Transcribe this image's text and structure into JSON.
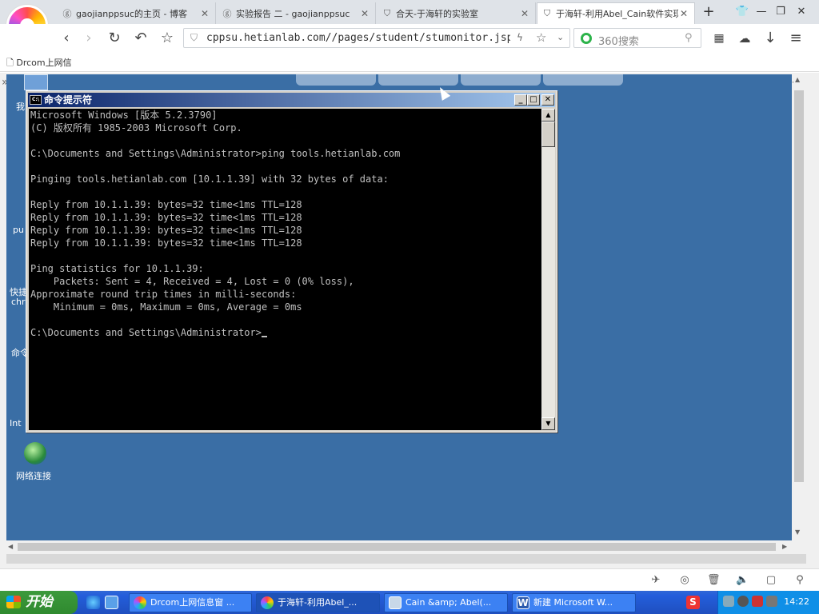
{
  "browser": {
    "tabs": [
      {
        "icon": "blog-icon",
        "label": "gaojianppsuc的主页 - 博客"
      },
      {
        "icon": "blog-icon",
        "label": "实验报告 二 - gaojianppsuc"
      },
      {
        "icon": "shield-icon",
        "label": "合天-于海轩的实验室"
      },
      {
        "icon": "shield-icon",
        "label": "于海轩-利用Abel_Cain软件实现"
      }
    ],
    "new_tab_label": "+",
    "url": "cppsu.hetianlab.com//pages/student/stumonitor.jsp",
    "search_placeholder": "360搜索",
    "bookmark": "Drcom上网信"
  },
  "desktop": {
    "icons": [
      {
        "label": "我"
      },
      {
        "label": "pu"
      },
      {
        "label": "快捷"
      },
      {
        "label": "chr"
      },
      {
        "label": "命令"
      },
      {
        "label": "Int"
      },
      {
        "label": "网络连接"
      }
    ]
  },
  "cmd": {
    "title": "命令提示符",
    "icon_text": "C:\\",
    "lines": [
      "Microsoft Windows [版本 5.2.3790]",
      "(C) 版权所有 1985-2003 Microsoft Corp.",
      "",
      "C:\\Documents and Settings\\Administrator>ping tools.hetianlab.com",
      "",
      "Pinging tools.hetianlab.com [10.1.1.39] with 32 bytes of data:",
      "",
      "Reply from 10.1.1.39: bytes=32 time<1ms TTL=128",
      "Reply from 10.1.1.39: bytes=32 time<1ms TTL=128",
      "Reply from 10.1.1.39: bytes=32 time<1ms TTL=128",
      "Reply from 10.1.1.39: bytes=32 time<1ms TTL=128",
      "",
      "Ping statistics for 10.1.1.39:",
      "    Packets: Sent = 4, Received = 4, Lost = 0 (0% loss),",
      "Approximate round trip times in milli-seconds:",
      "    Minimum = 0ms, Maximum = 0ms, Average = 0ms",
      "",
      "C:\\Documents and Settings\\Administrator>"
    ]
  },
  "taskbar": {
    "start_label": "开始",
    "buttons": [
      {
        "label": "Drcom上网信息窗 ..."
      },
      {
        "label": "于海轩-利用Abel_..."
      },
      {
        "label": "Cain &amp; Abel(..."
      },
      {
        "label": "新建 Microsoft W..."
      }
    ],
    "clock": "14:22"
  }
}
